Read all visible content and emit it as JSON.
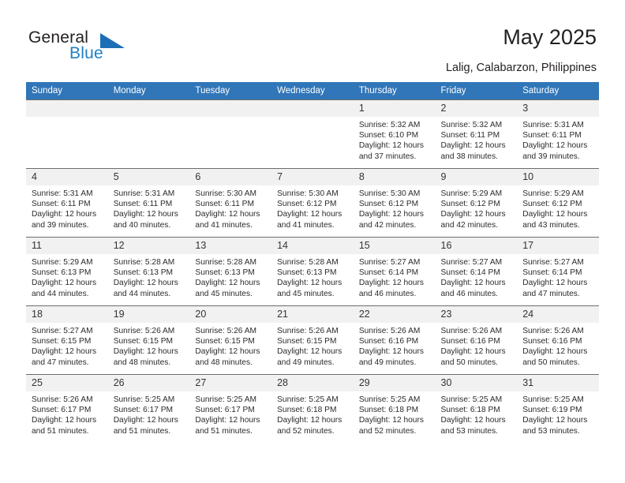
{
  "brand": {
    "name_top": "General",
    "name_bottom": "Blue",
    "triangle_color": "#1c6fb5",
    "text_color": "#231f20",
    "blue_color": "#1f7fc4"
  },
  "header": {
    "title": "May 2025",
    "subtitle": "Lalig, Calabarzon, Philippines",
    "accent_color": "#3076b8",
    "daynum_band_color": "#f1f1f1"
  },
  "weekdays": [
    "Sunday",
    "Monday",
    "Tuesday",
    "Wednesday",
    "Thursday",
    "Friday",
    "Saturday"
  ],
  "weeks": [
    [
      {
        "day": "",
        "sunrise": "",
        "sunset": "",
        "daylight_line1": "",
        "daylight_line2": ""
      },
      {
        "day": "",
        "sunrise": "",
        "sunset": "",
        "daylight_line1": "",
        "daylight_line2": ""
      },
      {
        "day": "",
        "sunrise": "",
        "sunset": "",
        "daylight_line1": "",
        "daylight_line2": ""
      },
      {
        "day": "",
        "sunrise": "",
        "sunset": "",
        "daylight_line1": "",
        "daylight_line2": ""
      },
      {
        "day": "1",
        "sunrise": "Sunrise: 5:32 AM",
        "sunset": "Sunset: 6:10 PM",
        "daylight_line1": "Daylight: 12 hours",
        "daylight_line2": "and 37 minutes."
      },
      {
        "day": "2",
        "sunrise": "Sunrise: 5:32 AM",
        "sunset": "Sunset: 6:11 PM",
        "daylight_line1": "Daylight: 12 hours",
        "daylight_line2": "and 38 minutes."
      },
      {
        "day": "3",
        "sunrise": "Sunrise: 5:31 AM",
        "sunset": "Sunset: 6:11 PM",
        "daylight_line1": "Daylight: 12 hours",
        "daylight_line2": "and 39 minutes."
      }
    ],
    [
      {
        "day": "4",
        "sunrise": "Sunrise: 5:31 AM",
        "sunset": "Sunset: 6:11 PM",
        "daylight_line1": "Daylight: 12 hours",
        "daylight_line2": "and 39 minutes."
      },
      {
        "day": "5",
        "sunrise": "Sunrise: 5:31 AM",
        "sunset": "Sunset: 6:11 PM",
        "daylight_line1": "Daylight: 12 hours",
        "daylight_line2": "and 40 minutes."
      },
      {
        "day": "6",
        "sunrise": "Sunrise: 5:30 AM",
        "sunset": "Sunset: 6:11 PM",
        "daylight_line1": "Daylight: 12 hours",
        "daylight_line2": "and 41 minutes."
      },
      {
        "day": "7",
        "sunrise": "Sunrise: 5:30 AM",
        "sunset": "Sunset: 6:12 PM",
        "daylight_line1": "Daylight: 12 hours",
        "daylight_line2": "and 41 minutes."
      },
      {
        "day": "8",
        "sunrise": "Sunrise: 5:30 AM",
        "sunset": "Sunset: 6:12 PM",
        "daylight_line1": "Daylight: 12 hours",
        "daylight_line2": "and 42 minutes."
      },
      {
        "day": "9",
        "sunrise": "Sunrise: 5:29 AM",
        "sunset": "Sunset: 6:12 PM",
        "daylight_line1": "Daylight: 12 hours",
        "daylight_line2": "and 42 minutes."
      },
      {
        "day": "10",
        "sunrise": "Sunrise: 5:29 AM",
        "sunset": "Sunset: 6:12 PM",
        "daylight_line1": "Daylight: 12 hours",
        "daylight_line2": "and 43 minutes."
      }
    ],
    [
      {
        "day": "11",
        "sunrise": "Sunrise: 5:29 AM",
        "sunset": "Sunset: 6:13 PM",
        "daylight_line1": "Daylight: 12 hours",
        "daylight_line2": "and 44 minutes."
      },
      {
        "day": "12",
        "sunrise": "Sunrise: 5:28 AM",
        "sunset": "Sunset: 6:13 PM",
        "daylight_line1": "Daylight: 12 hours",
        "daylight_line2": "and 44 minutes."
      },
      {
        "day": "13",
        "sunrise": "Sunrise: 5:28 AM",
        "sunset": "Sunset: 6:13 PM",
        "daylight_line1": "Daylight: 12 hours",
        "daylight_line2": "and 45 minutes."
      },
      {
        "day": "14",
        "sunrise": "Sunrise: 5:28 AM",
        "sunset": "Sunset: 6:13 PM",
        "daylight_line1": "Daylight: 12 hours",
        "daylight_line2": "and 45 minutes."
      },
      {
        "day": "15",
        "sunrise": "Sunrise: 5:27 AM",
        "sunset": "Sunset: 6:14 PM",
        "daylight_line1": "Daylight: 12 hours",
        "daylight_line2": "and 46 minutes."
      },
      {
        "day": "16",
        "sunrise": "Sunrise: 5:27 AM",
        "sunset": "Sunset: 6:14 PM",
        "daylight_line1": "Daylight: 12 hours",
        "daylight_line2": "and 46 minutes."
      },
      {
        "day": "17",
        "sunrise": "Sunrise: 5:27 AM",
        "sunset": "Sunset: 6:14 PM",
        "daylight_line1": "Daylight: 12 hours",
        "daylight_line2": "and 47 minutes."
      }
    ],
    [
      {
        "day": "18",
        "sunrise": "Sunrise: 5:27 AM",
        "sunset": "Sunset: 6:15 PM",
        "daylight_line1": "Daylight: 12 hours",
        "daylight_line2": "and 47 minutes."
      },
      {
        "day": "19",
        "sunrise": "Sunrise: 5:26 AM",
        "sunset": "Sunset: 6:15 PM",
        "daylight_line1": "Daylight: 12 hours",
        "daylight_line2": "and 48 minutes."
      },
      {
        "day": "20",
        "sunrise": "Sunrise: 5:26 AM",
        "sunset": "Sunset: 6:15 PM",
        "daylight_line1": "Daylight: 12 hours",
        "daylight_line2": "and 48 minutes."
      },
      {
        "day": "21",
        "sunrise": "Sunrise: 5:26 AM",
        "sunset": "Sunset: 6:15 PM",
        "daylight_line1": "Daylight: 12 hours",
        "daylight_line2": "and 49 minutes."
      },
      {
        "day": "22",
        "sunrise": "Sunrise: 5:26 AM",
        "sunset": "Sunset: 6:16 PM",
        "daylight_line1": "Daylight: 12 hours",
        "daylight_line2": "and 49 minutes."
      },
      {
        "day": "23",
        "sunrise": "Sunrise: 5:26 AM",
        "sunset": "Sunset: 6:16 PM",
        "daylight_line1": "Daylight: 12 hours",
        "daylight_line2": "and 50 minutes."
      },
      {
        "day": "24",
        "sunrise": "Sunrise: 5:26 AM",
        "sunset": "Sunset: 6:16 PM",
        "daylight_line1": "Daylight: 12 hours",
        "daylight_line2": "and 50 minutes."
      }
    ],
    [
      {
        "day": "25",
        "sunrise": "Sunrise: 5:26 AM",
        "sunset": "Sunset: 6:17 PM",
        "daylight_line1": "Daylight: 12 hours",
        "daylight_line2": "and 51 minutes."
      },
      {
        "day": "26",
        "sunrise": "Sunrise: 5:25 AM",
        "sunset": "Sunset: 6:17 PM",
        "daylight_line1": "Daylight: 12 hours",
        "daylight_line2": "and 51 minutes."
      },
      {
        "day": "27",
        "sunrise": "Sunrise: 5:25 AM",
        "sunset": "Sunset: 6:17 PM",
        "daylight_line1": "Daylight: 12 hours",
        "daylight_line2": "and 51 minutes."
      },
      {
        "day": "28",
        "sunrise": "Sunrise: 5:25 AM",
        "sunset": "Sunset: 6:18 PM",
        "daylight_line1": "Daylight: 12 hours",
        "daylight_line2": "and 52 minutes."
      },
      {
        "day": "29",
        "sunrise": "Sunrise: 5:25 AM",
        "sunset": "Sunset: 6:18 PM",
        "daylight_line1": "Daylight: 12 hours",
        "daylight_line2": "and 52 minutes."
      },
      {
        "day": "30",
        "sunrise": "Sunrise: 5:25 AM",
        "sunset": "Sunset: 6:18 PM",
        "daylight_line1": "Daylight: 12 hours",
        "daylight_line2": "and 53 minutes."
      },
      {
        "day": "31",
        "sunrise": "Sunrise: 5:25 AM",
        "sunset": "Sunset: 6:19 PM",
        "daylight_line1": "Daylight: 12 hours",
        "daylight_line2": "and 53 minutes."
      }
    ]
  ]
}
